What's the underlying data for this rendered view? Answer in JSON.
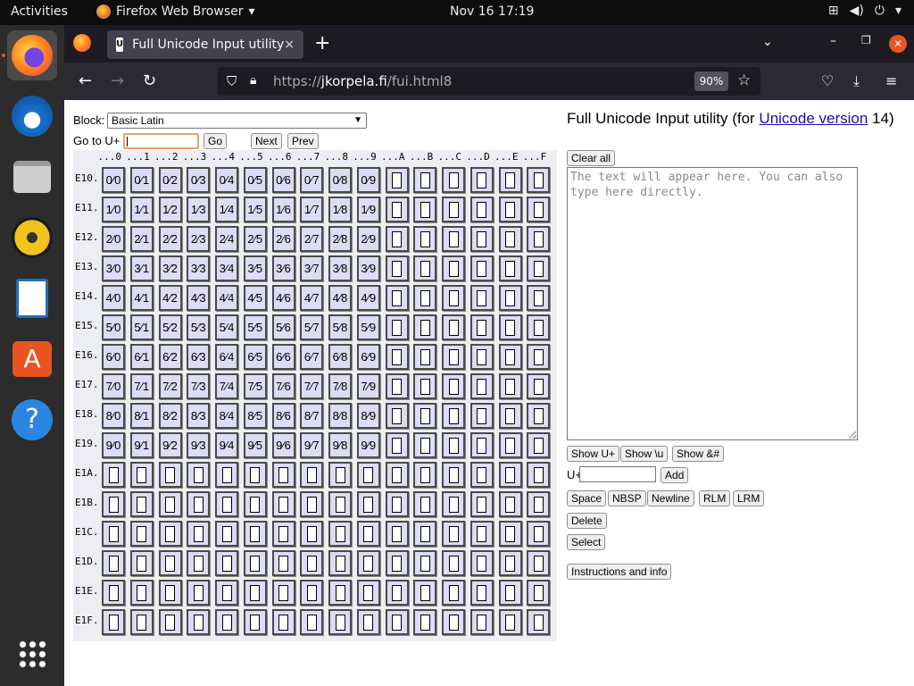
{
  "topbar": {
    "activities": "Activities",
    "app_name": "Firefox Web Browser",
    "clock": "Nov 16  17:19"
  },
  "dock": {
    "items": [
      "firefox-icon",
      "thunderbird-icon",
      "files-icon",
      "rhythmbox-icon",
      "writer-icon",
      "app-center-icon",
      "help-icon",
      "show-apps-icon"
    ]
  },
  "browser": {
    "tab_title": "Full Unicode Input utility",
    "tab_close": "×",
    "new_tab": "+",
    "url_prefix": "https://",
    "url_domain": "jkorpela.fi",
    "url_path": "/fui.html8",
    "zoom": "90%"
  },
  "page": {
    "block_label": "Block:",
    "block_value": "Basic Latin",
    "goto_label": "Go to U+",
    "go_button": "Go",
    "next_button": "Next",
    "prev_button": "Prev",
    "heading_text": "Full Unicode Input utility (for ",
    "heading_link": "Unicode version",
    "heading_tail": " 14)",
    "clear_all": "Clear all",
    "textarea_placeholder": "The text will appear here. You can also type here directly.",
    "show_uplus": "Show U+",
    "show_u": "Show \\u",
    "show_amp": "Show &#",
    "uplus_label": "U+",
    "add_button": "Add",
    "space": "Space",
    "nbsp": "NBSP",
    "newline": "Newline",
    "rlm": "RLM",
    "lrm": "LRM",
    "delete": "Delete",
    "select": "Select",
    "instructions": "Instructions and info"
  },
  "grid": {
    "col_heads": [
      "...0",
      "...1",
      "...2",
      "...3",
      "...4",
      "...5",
      "...6",
      "...7",
      "...8",
      "...9",
      "...A",
      "...B",
      "...C",
      "...D",
      "...E",
      "...F"
    ],
    "row_heads": [
      "E10.",
      "E11.",
      "E12.",
      "E13.",
      "E14.",
      "E15.",
      "E16.",
      "E17.",
      "E18.",
      "E19.",
      "E1A.",
      "E1B.",
      "E1C.",
      "E1D.",
      "E1E.",
      "E1F."
    ],
    "fraction_rows": [
      [
        "0⁄0",
        "0⁄1",
        "0⁄2",
        "0⁄3",
        "0⁄4",
        "0⁄5",
        "0⁄6",
        "0⁄7",
        "0⁄8",
        "0⁄9"
      ],
      [
        "1⁄0",
        "1⁄1",
        "1⁄2",
        "1⁄3",
        "1⁄4",
        "1⁄5",
        "1⁄6",
        "1⁄7",
        "1⁄8",
        "1⁄9"
      ],
      [
        "2⁄0",
        "2⁄1",
        "2⁄2",
        "2⁄3",
        "2⁄4",
        "2⁄5",
        "2⁄6",
        "2⁄7",
        "2⁄8",
        "2⁄9"
      ],
      [
        "3⁄0",
        "3⁄1",
        "3⁄2",
        "3⁄3",
        "3⁄4",
        "3⁄5",
        "3⁄6",
        "3⁄7",
        "3⁄8",
        "3⁄9"
      ],
      [
        "4⁄0",
        "4⁄1",
        "4⁄2",
        "4⁄3",
        "4⁄4",
        "4⁄5",
        "4⁄6",
        "4⁄7",
        "4⁄8",
        "4⁄9"
      ],
      [
        "5⁄0",
        "5⁄1",
        "5⁄2",
        "5⁄3",
        "5⁄4",
        "5⁄5",
        "5⁄6",
        "5⁄7",
        "5⁄8",
        "5⁄9"
      ],
      [
        "6⁄0",
        "6⁄1",
        "6⁄2",
        "6⁄3",
        "6⁄4",
        "6⁄5",
        "6⁄6",
        "6⁄7",
        "6⁄8",
        "6⁄9"
      ],
      [
        "7⁄0",
        "7⁄1",
        "7⁄2",
        "7⁄3",
        "7⁄4",
        "7⁄5",
        "7⁄6",
        "7⁄7",
        "7⁄8",
        "7⁄9"
      ],
      [
        "8⁄0",
        "8⁄1",
        "8⁄2",
        "8⁄3",
        "8⁄4",
        "8⁄5",
        "8⁄6",
        "8⁄7",
        "8⁄8",
        "8⁄9"
      ],
      [
        "9⁄0",
        "9⁄1",
        "9⁄2",
        "9⁄3",
        "9⁄4",
        "9⁄5",
        "9⁄6",
        "9⁄7",
        "9⁄8",
        "9⁄9"
      ]
    ]
  }
}
